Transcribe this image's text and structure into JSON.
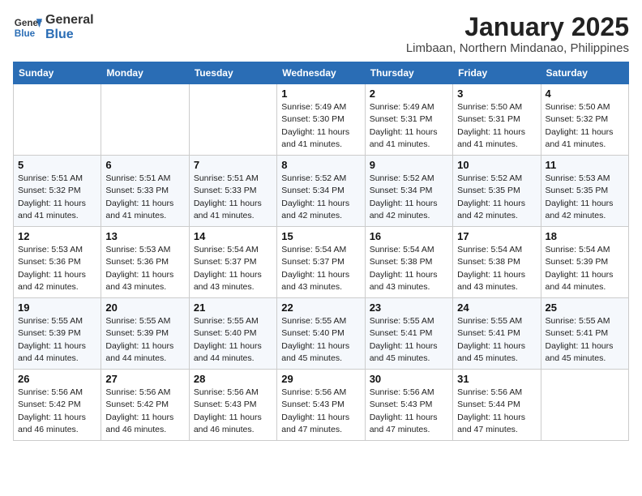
{
  "logo": {
    "line1": "General",
    "line2": "Blue"
  },
  "title": "January 2025",
  "location": "Limbaan, Northern Mindanao, Philippines",
  "days_of_week": [
    "Sunday",
    "Monday",
    "Tuesday",
    "Wednesday",
    "Thursday",
    "Friday",
    "Saturday"
  ],
  "weeks": [
    [
      {
        "day": "",
        "info": ""
      },
      {
        "day": "",
        "info": ""
      },
      {
        "day": "",
        "info": ""
      },
      {
        "day": "1",
        "info": "Sunrise: 5:49 AM\nSunset: 5:30 PM\nDaylight: 11 hours and 41 minutes."
      },
      {
        "day": "2",
        "info": "Sunrise: 5:49 AM\nSunset: 5:31 PM\nDaylight: 11 hours and 41 minutes."
      },
      {
        "day": "3",
        "info": "Sunrise: 5:50 AM\nSunset: 5:31 PM\nDaylight: 11 hours and 41 minutes."
      },
      {
        "day": "4",
        "info": "Sunrise: 5:50 AM\nSunset: 5:32 PM\nDaylight: 11 hours and 41 minutes."
      }
    ],
    [
      {
        "day": "5",
        "info": "Sunrise: 5:51 AM\nSunset: 5:32 PM\nDaylight: 11 hours and 41 minutes."
      },
      {
        "day": "6",
        "info": "Sunrise: 5:51 AM\nSunset: 5:33 PM\nDaylight: 11 hours and 41 minutes."
      },
      {
        "day": "7",
        "info": "Sunrise: 5:51 AM\nSunset: 5:33 PM\nDaylight: 11 hours and 41 minutes."
      },
      {
        "day": "8",
        "info": "Sunrise: 5:52 AM\nSunset: 5:34 PM\nDaylight: 11 hours and 42 minutes."
      },
      {
        "day": "9",
        "info": "Sunrise: 5:52 AM\nSunset: 5:34 PM\nDaylight: 11 hours and 42 minutes."
      },
      {
        "day": "10",
        "info": "Sunrise: 5:52 AM\nSunset: 5:35 PM\nDaylight: 11 hours and 42 minutes."
      },
      {
        "day": "11",
        "info": "Sunrise: 5:53 AM\nSunset: 5:35 PM\nDaylight: 11 hours and 42 minutes."
      }
    ],
    [
      {
        "day": "12",
        "info": "Sunrise: 5:53 AM\nSunset: 5:36 PM\nDaylight: 11 hours and 42 minutes."
      },
      {
        "day": "13",
        "info": "Sunrise: 5:53 AM\nSunset: 5:36 PM\nDaylight: 11 hours and 43 minutes."
      },
      {
        "day": "14",
        "info": "Sunrise: 5:54 AM\nSunset: 5:37 PM\nDaylight: 11 hours and 43 minutes."
      },
      {
        "day": "15",
        "info": "Sunrise: 5:54 AM\nSunset: 5:37 PM\nDaylight: 11 hours and 43 minutes."
      },
      {
        "day": "16",
        "info": "Sunrise: 5:54 AM\nSunset: 5:38 PM\nDaylight: 11 hours and 43 minutes."
      },
      {
        "day": "17",
        "info": "Sunrise: 5:54 AM\nSunset: 5:38 PM\nDaylight: 11 hours and 43 minutes."
      },
      {
        "day": "18",
        "info": "Sunrise: 5:54 AM\nSunset: 5:39 PM\nDaylight: 11 hours and 44 minutes."
      }
    ],
    [
      {
        "day": "19",
        "info": "Sunrise: 5:55 AM\nSunset: 5:39 PM\nDaylight: 11 hours and 44 minutes."
      },
      {
        "day": "20",
        "info": "Sunrise: 5:55 AM\nSunset: 5:39 PM\nDaylight: 11 hours and 44 minutes."
      },
      {
        "day": "21",
        "info": "Sunrise: 5:55 AM\nSunset: 5:40 PM\nDaylight: 11 hours and 44 minutes."
      },
      {
        "day": "22",
        "info": "Sunrise: 5:55 AM\nSunset: 5:40 PM\nDaylight: 11 hours and 45 minutes."
      },
      {
        "day": "23",
        "info": "Sunrise: 5:55 AM\nSunset: 5:41 PM\nDaylight: 11 hours and 45 minutes."
      },
      {
        "day": "24",
        "info": "Sunrise: 5:55 AM\nSunset: 5:41 PM\nDaylight: 11 hours and 45 minutes."
      },
      {
        "day": "25",
        "info": "Sunrise: 5:55 AM\nSunset: 5:41 PM\nDaylight: 11 hours and 45 minutes."
      }
    ],
    [
      {
        "day": "26",
        "info": "Sunrise: 5:56 AM\nSunset: 5:42 PM\nDaylight: 11 hours and 46 minutes."
      },
      {
        "day": "27",
        "info": "Sunrise: 5:56 AM\nSunset: 5:42 PM\nDaylight: 11 hours and 46 minutes."
      },
      {
        "day": "28",
        "info": "Sunrise: 5:56 AM\nSunset: 5:43 PM\nDaylight: 11 hours and 46 minutes."
      },
      {
        "day": "29",
        "info": "Sunrise: 5:56 AM\nSunset: 5:43 PM\nDaylight: 11 hours and 47 minutes."
      },
      {
        "day": "30",
        "info": "Sunrise: 5:56 AM\nSunset: 5:43 PM\nDaylight: 11 hours and 47 minutes."
      },
      {
        "day": "31",
        "info": "Sunrise: 5:56 AM\nSunset: 5:44 PM\nDaylight: 11 hours and 47 minutes."
      },
      {
        "day": "",
        "info": ""
      }
    ]
  ]
}
